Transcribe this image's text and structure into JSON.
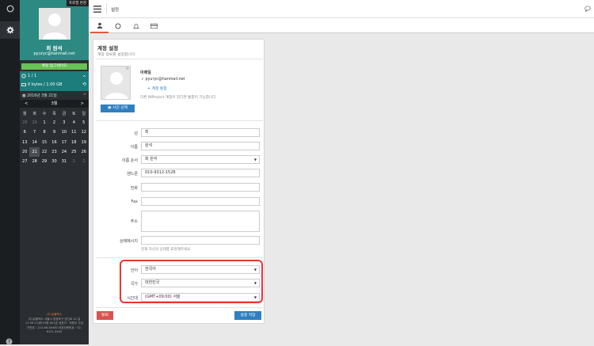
{
  "sidebar": {
    "edit_profile_label": "프로필 변경",
    "user_name": "최 원석",
    "user_email": "pyuryc@hanmail.net",
    "upgrade_label": "계정 업그레이드",
    "projects": "1 / 1",
    "storage": "0 bytes / 1.00 GB",
    "date_label": "2016년 3월 21일",
    "month": "3월",
    "weekdays": [
      "월",
      "화",
      "수",
      "목",
      "금",
      "토",
      "일"
    ],
    "weeks": [
      [
        "28",
        "29",
        "1",
        "2",
        "3",
        "4",
        "5"
      ],
      [
        "6",
        "7",
        "8",
        "9",
        "10",
        "11",
        "12"
      ],
      [
        "13",
        "14",
        "15",
        "16",
        "17",
        "18",
        "19"
      ],
      [
        "20",
        "21",
        "22",
        "23",
        "24",
        "25",
        "26"
      ],
      [
        "27",
        "28",
        "29",
        "30",
        "31",
        "1",
        "2"
      ]
    ],
    "footer_org": "(주)유플렉스",
    "footer_lines": [
      "(주)유플렉스 서울시 영등포구 양산로 41 길",
      "11 SK V1센터 6층 601호 대표자 : 최형주 사업",
      "자번호 : 214-86-50460 대표전화번호 : 02-",
      "6121-5400"
    ],
    "help_icon": "question-circle-icon"
  },
  "rail": {
    "icons": [
      "circle-icon",
      "gear-icon"
    ]
  },
  "topbar": {
    "title": "설정",
    "menu_icon": "hamburger-menu-icon",
    "chat_icon": "chat-bubble-icon"
  },
  "tabs": [
    {
      "name": "tab-account",
      "icon": "user-icon",
      "selected": true
    },
    {
      "name": "tab-status",
      "icon": "circle-icon",
      "selected": false
    },
    {
      "name": "tab-notifications",
      "icon": "bell-icon",
      "selected": false
    },
    {
      "name": "tab-payment",
      "icon": "credit-card-icon",
      "selected": false
    }
  ],
  "account": {
    "title": "계정 설정",
    "subtitle": "계정 정보를 설정합니다.",
    "email_heading": "이메일",
    "email_value": "pyuryc@hanmail.net",
    "merge_label": "+ 계정 통합",
    "merge_note": "다른 INProject 계정이 있다면 통합이 가능합니다.",
    "photo_button": "사진 선택",
    "fields": {
      "last_name": {
        "label": "성",
        "value": "최"
      },
      "first_name": {
        "label": "이름",
        "value": "원석"
      },
      "name_order": {
        "label": "이름 순서",
        "value": "최 원석"
      },
      "mobile": {
        "label": "핸드폰",
        "value": "010-9312-1528"
      },
      "phone": {
        "label": "전화",
        "value": ""
      },
      "fax": {
        "label": "Fax",
        "value": ""
      },
      "address": {
        "label": "주소",
        "value": ""
      },
      "status_message": {
        "label": "상태메시지",
        "value": "",
        "hint": "현재 자신의 상태를 표현해주세요."
      },
      "language": {
        "label": "언어",
        "value": "한국어"
      },
      "country": {
        "label": "국가",
        "value": "대한민국"
      },
      "timezone": {
        "label": "시간대",
        "value": "(GMT+09:00) 서울"
      }
    },
    "leave_button": "탈퇴",
    "save_button": "설정 저장"
  },
  "colors": {
    "accent": "#2f7fc1",
    "danger": "#d9534f",
    "sidebar": "#2a2e32",
    "teal": "#1c7d7c",
    "upgrade": "#6bc055",
    "highlight": "#e33333"
  }
}
